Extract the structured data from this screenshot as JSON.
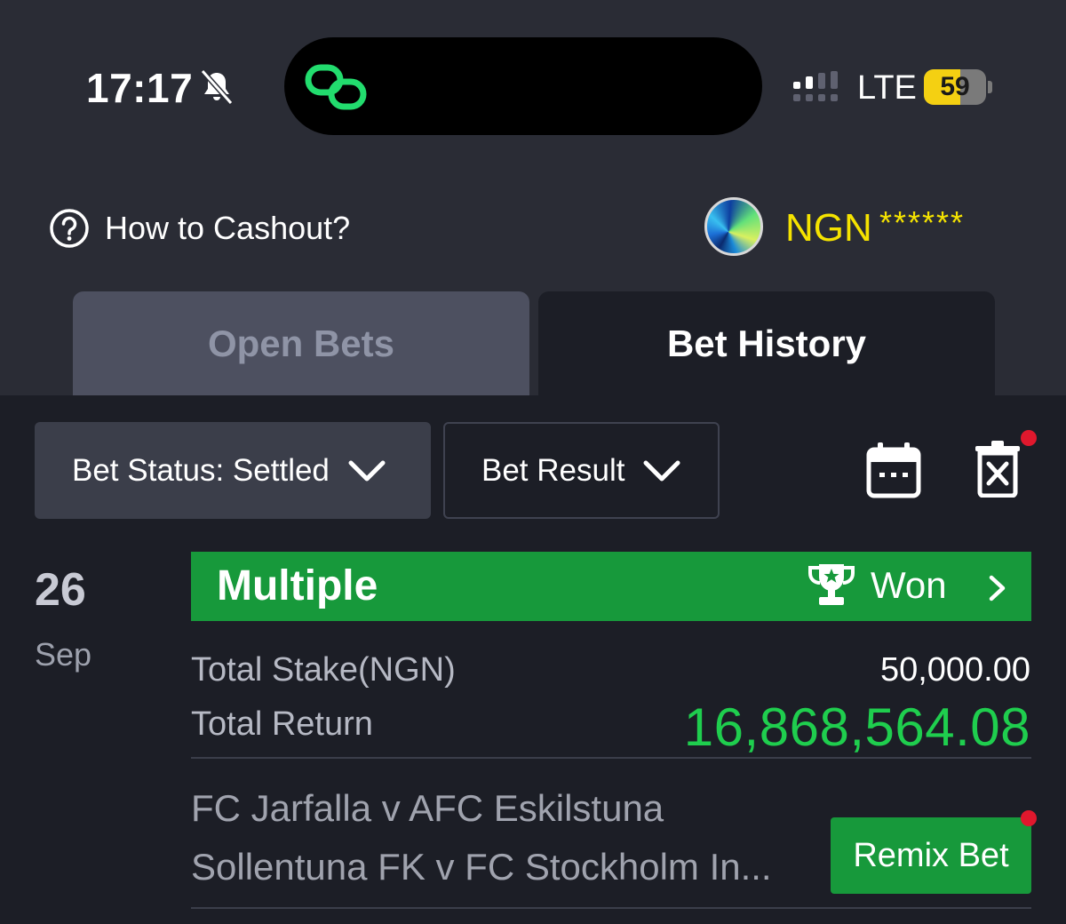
{
  "status_bar": {
    "time": "17:17",
    "network": "LTE",
    "battery": "59",
    "battery_level": 0.59,
    "icons": [
      "bell-muted-icon",
      "link-icon",
      "signal-icon"
    ]
  },
  "header": {
    "help_label": "How to Cashout?",
    "currency": "NGN",
    "balance_masked": "******"
  },
  "tabs": [
    {
      "label": "Open Bets",
      "active": false
    },
    {
      "label": "Bet History",
      "active": true
    }
  ],
  "filters": {
    "status_label": "Bet Status: Settled",
    "result_label": "Bet Result"
  },
  "bet": {
    "day": "26",
    "month": "Sep",
    "type": "Multiple",
    "result": "Won",
    "stake_label": "Total Stake(NGN)",
    "stake_value": "50,000.00",
    "return_label": "Total Return",
    "return_value": "16,868,564.08",
    "matches": [
      "FC Jarfalla v AFC Eskilstuna",
      "Sollentuna FK v FC Stockholm In..."
    ],
    "remix_label": "Remix Bet"
  },
  "colors": {
    "accent_green": "#17993b",
    "return_green": "#1fce4e",
    "balance_yellow": "#f5e300",
    "notification_red": "#e0182d"
  }
}
